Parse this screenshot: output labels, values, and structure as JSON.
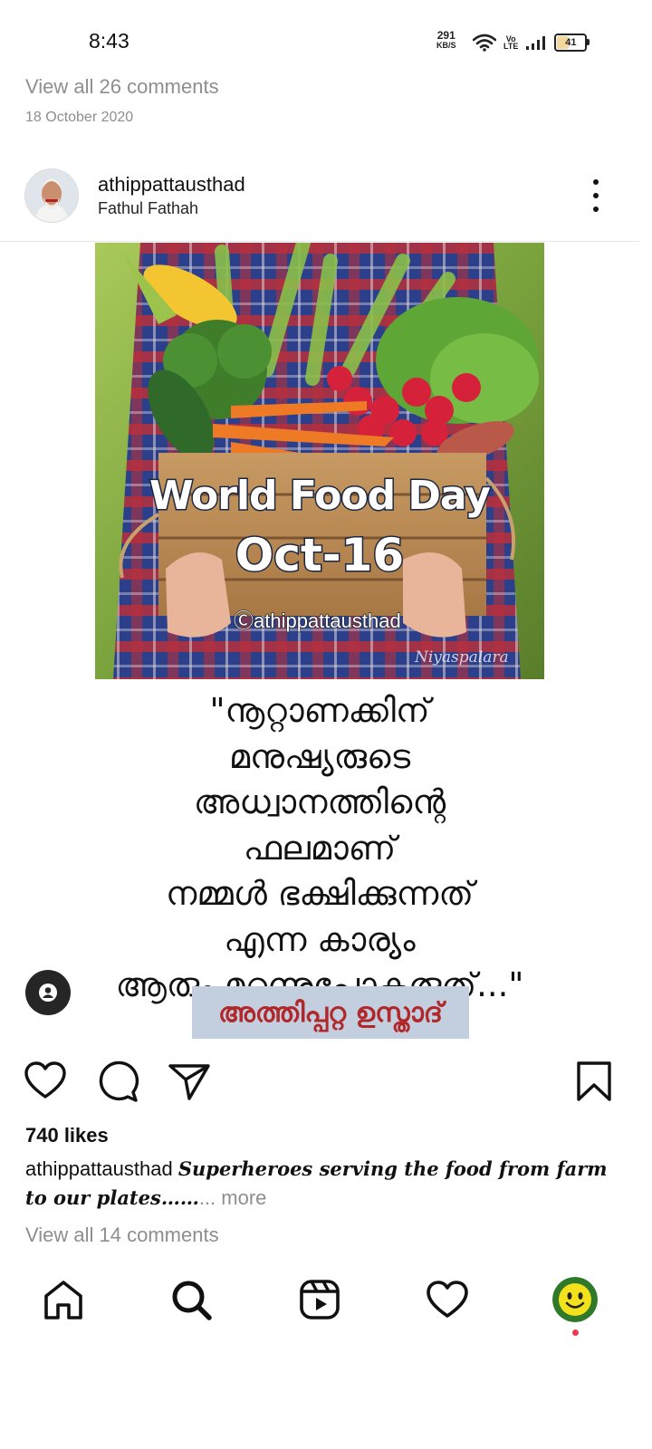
{
  "status_bar": {
    "time": "8:43",
    "speed_value": "291",
    "speed_unit": "KB/S",
    "network_label_top": "Vo",
    "network_label_bottom": "LTE",
    "battery": "41"
  },
  "previous_post": {
    "view_comments": "View all 26 comments",
    "date": "18 October 2020"
  },
  "post": {
    "username": "athippattausthad",
    "location": "Fathul Fathah",
    "image": {
      "title": "World Food Day",
      "date_text": "Oct-16",
      "handle": "Ⓒathippattausthad",
      "signature": "Niyaspalara"
    },
    "quote_lines": [
      "\"നൂറ്റാണക്കിന്",
      "മനുഷ്യരുടെ",
      "അധ്വാനത്തിന്റെ",
      "ഫലമാണ്",
      "നമ്മൾ ഭക്ഷിക്കുന്നത്",
      "എന്ന കാര്യം",
      "ആരും മറന്നുപോകരുത്...\""
    ],
    "quote_author": "അത്തിപ്പറ്റ ഉസ്താദ്",
    "likes": "740 likes",
    "caption_username": "athippattausthad",
    "caption_text": "Superheroes serving the food from farm to our plates……",
    "caption_more": "... more",
    "view_comments": "View all 14 comments"
  },
  "icons": {
    "like": "heart-icon",
    "comment": "comment-bubble-icon",
    "share": "paper-plane-icon",
    "save": "bookmark-icon",
    "tag": "user-tag-icon",
    "nav_home": "home-icon",
    "nav_search": "search-icon",
    "nav_reels": "reels-icon",
    "nav_activity": "heart-icon"
  },
  "colors": {
    "secondary_text": "#8e8e8e",
    "author_text": "#b0282a",
    "author_bg": "#c3cede",
    "notification_dot": "#ef3a4e"
  }
}
